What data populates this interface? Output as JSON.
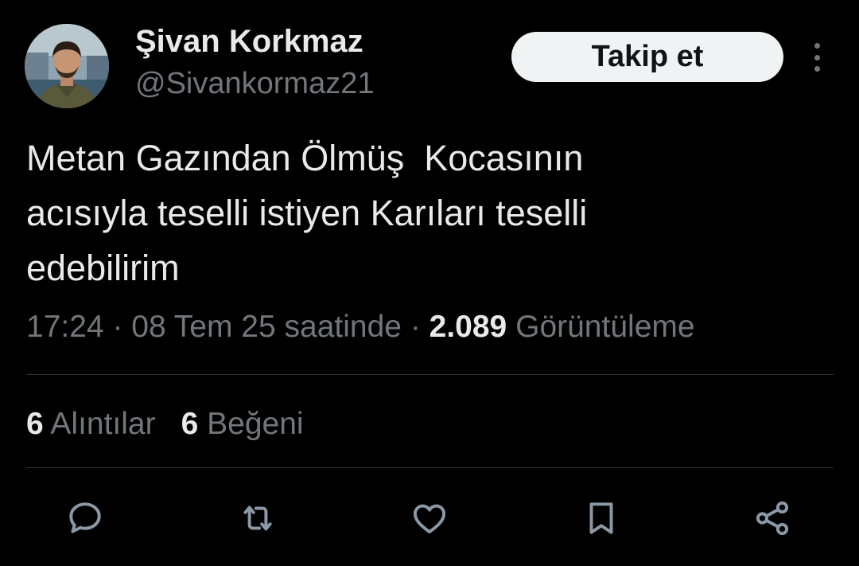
{
  "author": {
    "display_name": "Şivan Korkmaz",
    "handle": "@Sivankormaz21"
  },
  "header": {
    "follow_label": "Takip et"
  },
  "tweet": {
    "text": "Metan Gazından Ölmüş  Kocasının\nacısıyla teselli istiyen Karıları teselli\nedebilirim",
    "time": "17:24",
    "separator": " · ",
    "date_text": "08 Tem 25 saatinde",
    "views_count": "2.089",
    "views_label": "Görüntüleme"
  },
  "stats": {
    "quotes_count": "6",
    "quotes_label": "Alıntılar",
    "likes_count": "6",
    "likes_label": "Beğeni"
  },
  "actions": {
    "icons": [
      "reply-icon",
      "retweet-icon",
      "like-icon",
      "bookmark-icon",
      "share-icon"
    ]
  },
  "colors": {
    "background": "#000000",
    "primary_text": "#e7e9ea",
    "secondary_text": "#71767b",
    "divider": "#2f3336",
    "follow_button_bg": "#eff3f4",
    "follow_button_text": "#0f1419"
  }
}
